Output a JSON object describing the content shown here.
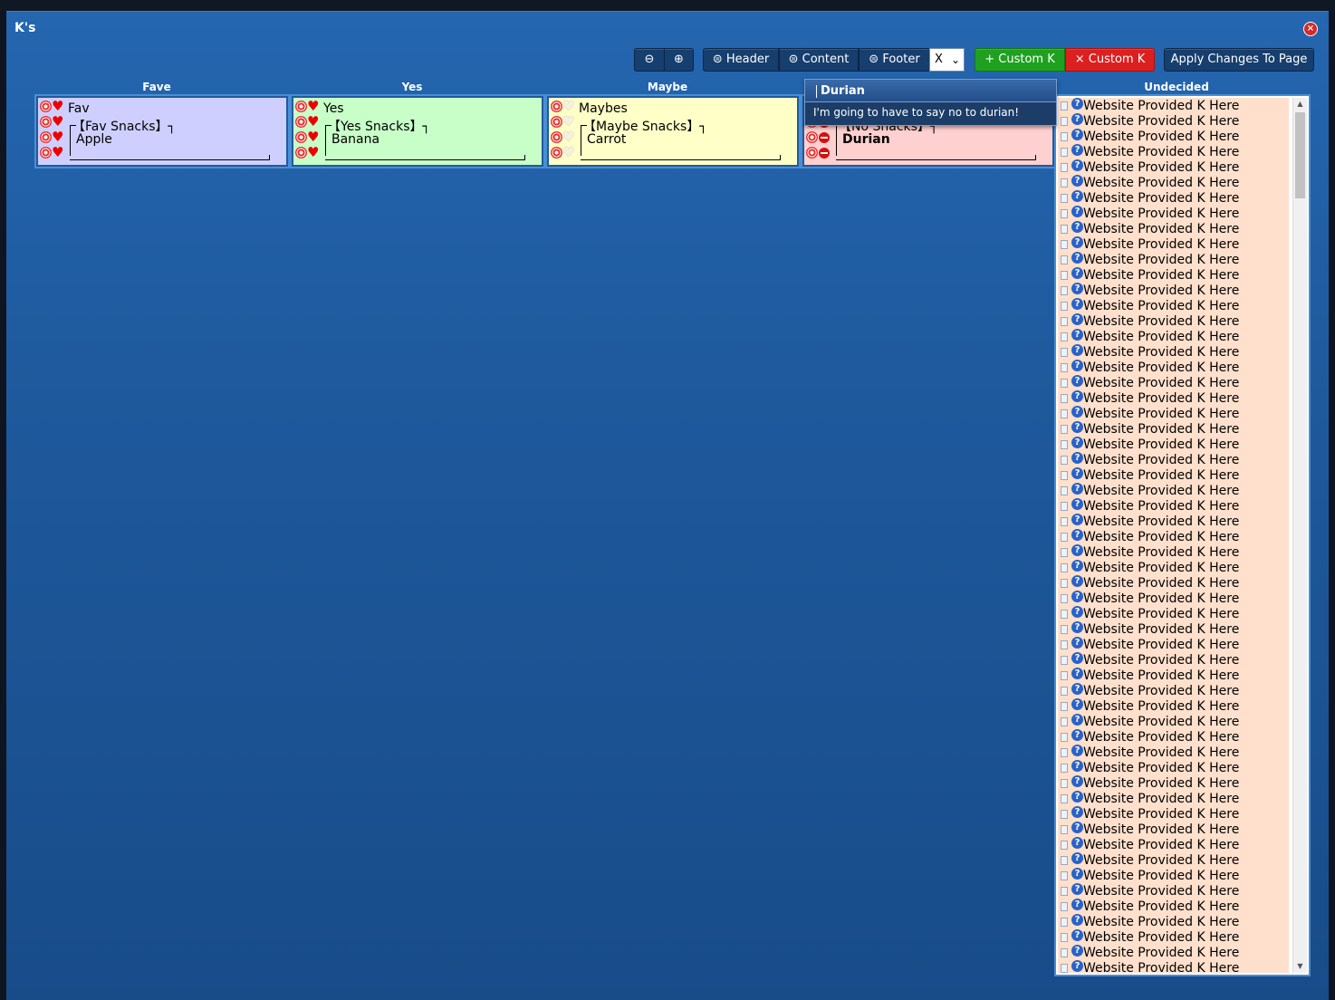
{
  "window": {
    "title": "K's",
    "close": "×"
  },
  "toolbar": {
    "zoom_out": "⊖",
    "zoom_in": "⊕",
    "header_label": "⊜ Header",
    "content_label": "⊜ Content",
    "footer_label": "⊜ Footer",
    "select_value": "X",
    "add_custom_label": "+ Custom K",
    "remove_custom_label": "× Custom K",
    "apply_label": "Apply Changes To Page"
  },
  "columns": [
    {
      "heading": "Fave",
      "label": "Fav",
      "subgroup": "【Fav Snacks】",
      "item": "Apple",
      "bracket_end": "┐"
    },
    {
      "heading": "Yes",
      "label": "Yes",
      "subgroup": "【Yes Snacks】",
      "item": "Banana",
      "bracket_end": "┐"
    },
    {
      "heading": "Maybe",
      "label": "Maybes",
      "subgroup": "【Maybe Snacks】",
      "item": "Carrot",
      "bracket_end": "┐"
    },
    {
      "heading": "",
      "label": "",
      "subgroup": "【No Snacks】",
      "item": "Durian",
      "bracket_end": "┐"
    }
  ],
  "tooltip": {
    "title": "Durian",
    "body": "I'm going to have to say no to durian!"
  },
  "undecided": {
    "heading": "Undecided",
    "item_label": "Website Provided K Here",
    "item_count": 57,
    "scroll_up": "▲",
    "scroll_down": "▼"
  },
  "icons": {
    "heart": "♥",
    "question": "?",
    "target": "target-icon",
    "minus": "minus-circle-icon",
    "chevron": "⌄"
  },
  "colors": {
    "window_top": "#2466b0",
    "window_bottom": "#184c89",
    "fave": "#cfcfff",
    "yes": "#c8ffc8",
    "maybe": "#ffffc8",
    "no": "#ffd0d0",
    "undecided": "#ffe0cc",
    "green_button": "#1fa11f",
    "red_button": "#dc1f1f"
  }
}
